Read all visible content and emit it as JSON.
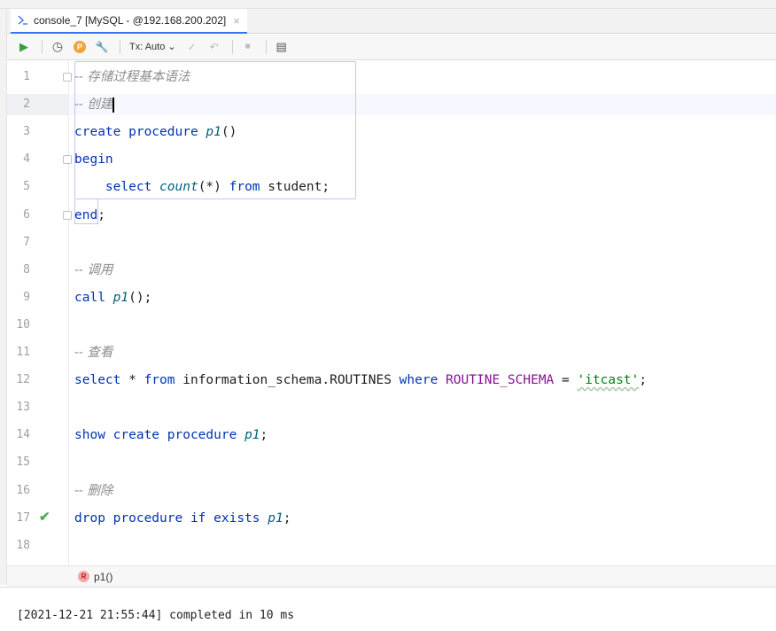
{
  "tab": {
    "title": "console_7 [MySQL - @192.168.200.202]",
    "close": "×"
  },
  "toolbar": {
    "run": "▶",
    "history": "◷",
    "profile": "P",
    "settings": "🔧",
    "tx_mode": "Tx: Auto ⌄",
    "commit": "✓",
    "rollback": "↶",
    "stop": "■",
    "layout": "▤"
  },
  "editor": {
    "line_numbers": [
      "1",
      "2",
      "3",
      "4",
      "5",
      "6",
      "7",
      "8",
      "9",
      "10",
      "11",
      "12",
      "13",
      "14",
      "15",
      "16",
      "17",
      "18"
    ],
    "lines": [
      [
        {
          "t": "cmt",
          "v": "-- 存储过程基本语法"
        }
      ],
      [
        {
          "t": "cmt",
          "v": "-- 创建"
        }
      ],
      [
        {
          "t": "kw",
          "v": "create procedure "
        },
        {
          "t": "fn",
          "v": "p1"
        },
        {
          "t": "punc",
          "v": "()"
        }
      ],
      [
        {
          "t": "kw",
          "v": "begin"
        }
      ],
      [
        {
          "t": "punc",
          "v": "    "
        },
        {
          "t": "kw",
          "v": "select "
        },
        {
          "t": "fn",
          "v": "count"
        },
        {
          "t": "punc",
          "v": "(*) "
        },
        {
          "t": "kw",
          "v": "from "
        },
        {
          "t": "ident",
          "v": "student"
        },
        {
          "t": "punc",
          "v": ";"
        }
      ],
      [
        {
          "t": "kw",
          "v": "end"
        },
        {
          "t": "punc",
          "v": ";"
        }
      ],
      [],
      [
        {
          "t": "cmt",
          "v": "-- 调用"
        }
      ],
      [
        {
          "t": "kw",
          "v": "call "
        },
        {
          "t": "fn",
          "v": "p1"
        },
        {
          "t": "punc",
          "v": "();"
        }
      ],
      [],
      [
        {
          "t": "cmt",
          "v": "-- 查看"
        }
      ],
      [
        {
          "t": "kw",
          "v": "select "
        },
        {
          "t": "punc",
          "v": "* "
        },
        {
          "t": "kw",
          "v": "from "
        },
        {
          "t": "ident",
          "v": "information_schema.ROUTINES "
        },
        {
          "t": "kw",
          "v": "where "
        },
        {
          "t": "col",
          "v": "ROUTINE_SCHEMA "
        },
        {
          "t": "punc",
          "v": "= "
        },
        {
          "t": "str",
          "v": "'itcast'"
        },
        {
          "t": "punc",
          "v": ";"
        }
      ],
      [],
      [
        {
          "t": "kw",
          "v": "show create procedure "
        },
        {
          "t": "fn",
          "v": "p1"
        },
        {
          "t": "punc",
          "v": ";"
        }
      ],
      [],
      [
        {
          "t": "cmt",
          "v": "-- 删除"
        }
      ],
      [
        {
          "t": "kw",
          "v": "drop procedure if exists "
        },
        {
          "t": "fn",
          "v": "p1"
        },
        {
          "t": "punc",
          "v": ";"
        }
      ],
      []
    ],
    "current_line": 2,
    "checked_line": 17
  },
  "breadcrumb": {
    "badge": "R",
    "label": "p1()"
  },
  "console": {
    "text": "[2021-12-21 21:55:44] completed in 10 ms"
  },
  "colors": {
    "keyword": "#0033b3",
    "function": "#00627a",
    "string": "#067d17",
    "column": "#871094",
    "comment": "#8c8c8c",
    "check": "#4caf50"
  }
}
